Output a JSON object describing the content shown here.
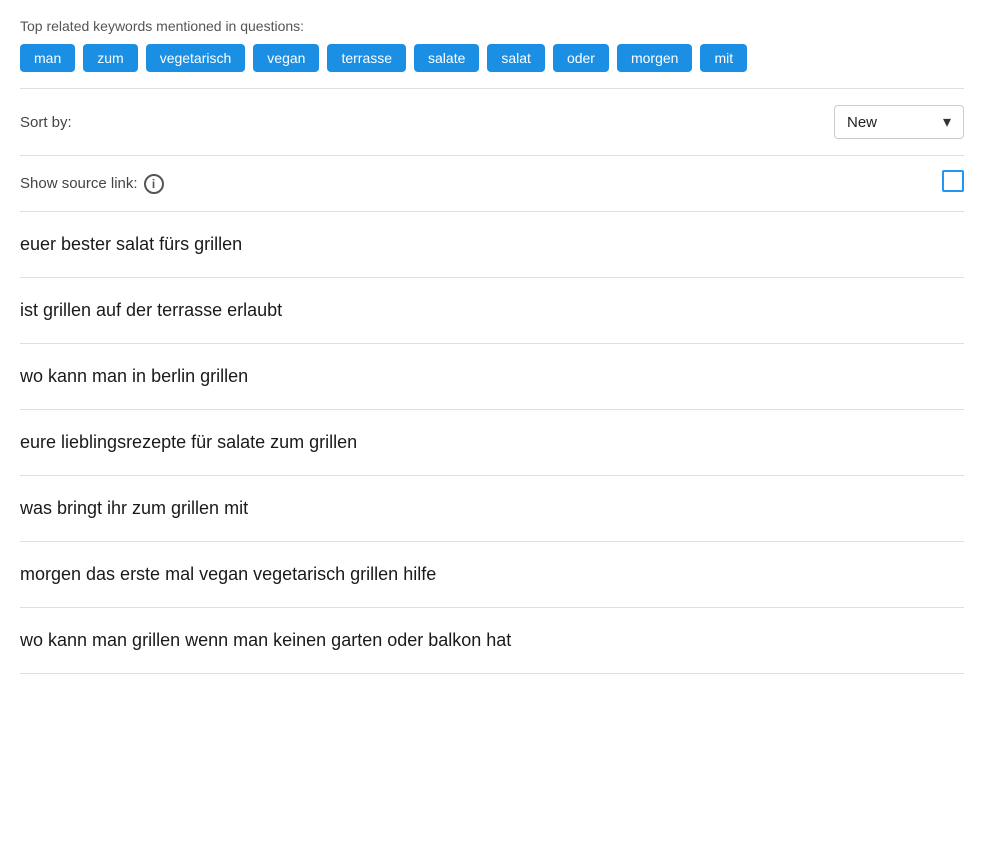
{
  "keywords_section": {
    "title": "Top related keywords mentioned in questions:",
    "keywords": [
      "man",
      "zum",
      "vegetarisch",
      "vegan",
      "terrasse",
      "salate",
      "salat",
      "oder",
      "morgen",
      "mit"
    ]
  },
  "sort_section": {
    "label": "Sort by:",
    "selected": "New",
    "chevron": "▾"
  },
  "source_link_section": {
    "label": "Show source link:",
    "info_symbol": "i"
  },
  "questions": [
    "euer bester salat fürs grillen",
    "ist grillen auf der terrasse erlaubt",
    "wo kann man in berlin grillen",
    "eure lieblingsrezepte für salate zum grillen",
    "was bringt ihr zum grillen mit",
    "morgen das erste mal vegan vegetarisch grillen hilfe",
    "wo kann man grillen wenn man keinen garten oder balkon hat"
  ]
}
